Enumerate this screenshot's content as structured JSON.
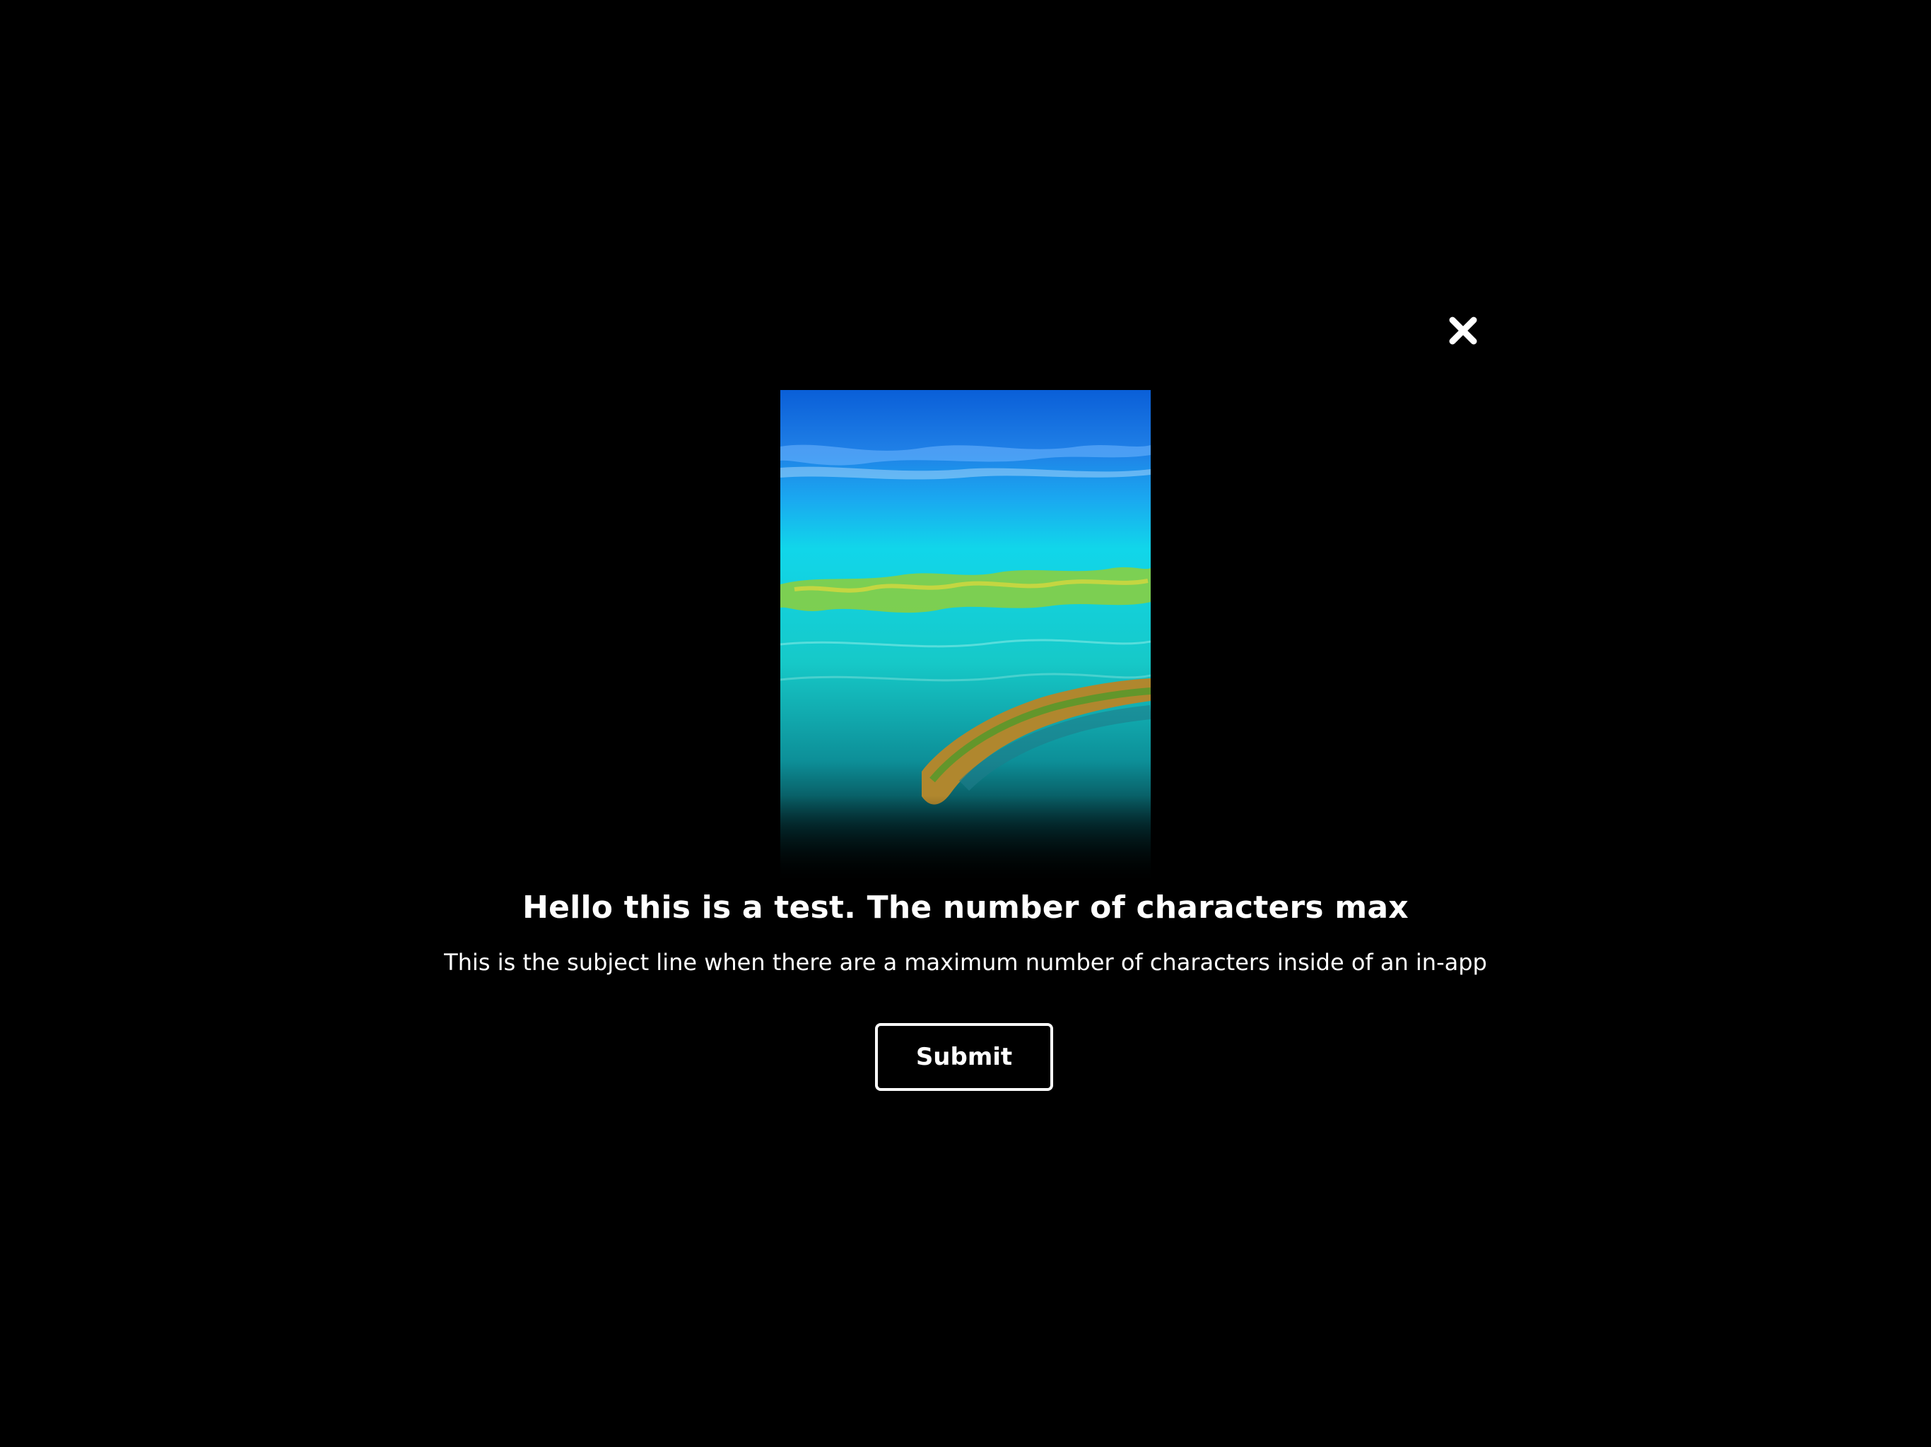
{
  "colors": {
    "background": "#000000",
    "text": "#ffffff",
    "button_border": "#ffffff"
  },
  "modal": {
    "close_icon": "close-icon",
    "hero_image": "ocean-reef-aerial-image",
    "headline": "Hello this is a test. The number of characters max",
    "subject": "This is the subject line when there are a maximum number of characters inside of an in-app",
    "submit_label": "Submit"
  }
}
